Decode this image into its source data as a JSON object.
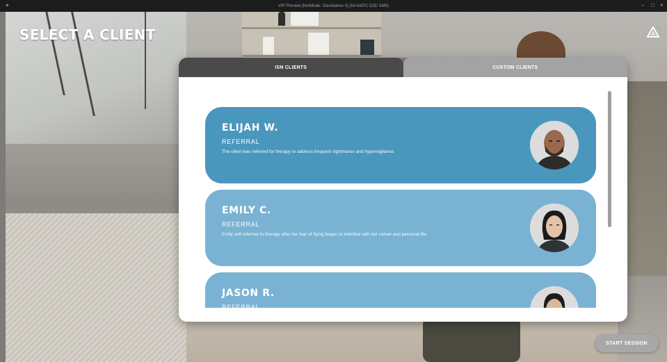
{
  "window": {
    "title": "VIP Preview [NetMode: Standalone 0] (64-bit/PC D3D SM6)",
    "minimize_glyph": "–",
    "maximize_glyph": "□",
    "close_glyph": "×"
  },
  "page": {
    "title": "SELECT A CLIENT",
    "logo_icon": "triangle-nodes-icon"
  },
  "tabs": [
    {
      "label": "ISN CLIENTS",
      "active": true
    },
    {
      "label": "CUSTOM CLIENTS",
      "active": false
    }
  ],
  "clients": [
    {
      "name": "ELIJAH W.",
      "type": "REFERRAL",
      "description": "The client was referred for therapy to address frequent nightmares and hypervigilance.",
      "card_color": "#4a97bd",
      "avatar_icon": "male-portrait-icon"
    },
    {
      "name": "EMILY C.",
      "type": "REFERRAL",
      "description": "Emily self-referred to therapy after her fear of flying began to interfere with her career and personal life.",
      "card_color": "#7ab2d3",
      "avatar_icon": "female-portrait-icon"
    },
    {
      "name": "JASON R.",
      "type": "REFERRAL",
      "description": "",
      "card_color": "#7ab2d3",
      "avatar_icon": "male-portrait-icon"
    }
  ],
  "footer": {
    "start_label": "START SESSION"
  },
  "colors": {
    "tab_active": "#4a4a4a",
    "tab_inactive": "#a3a3a3",
    "card_selected": "#4a97bd",
    "card_default": "#7ab2d3",
    "button": "#a8a8a8"
  }
}
